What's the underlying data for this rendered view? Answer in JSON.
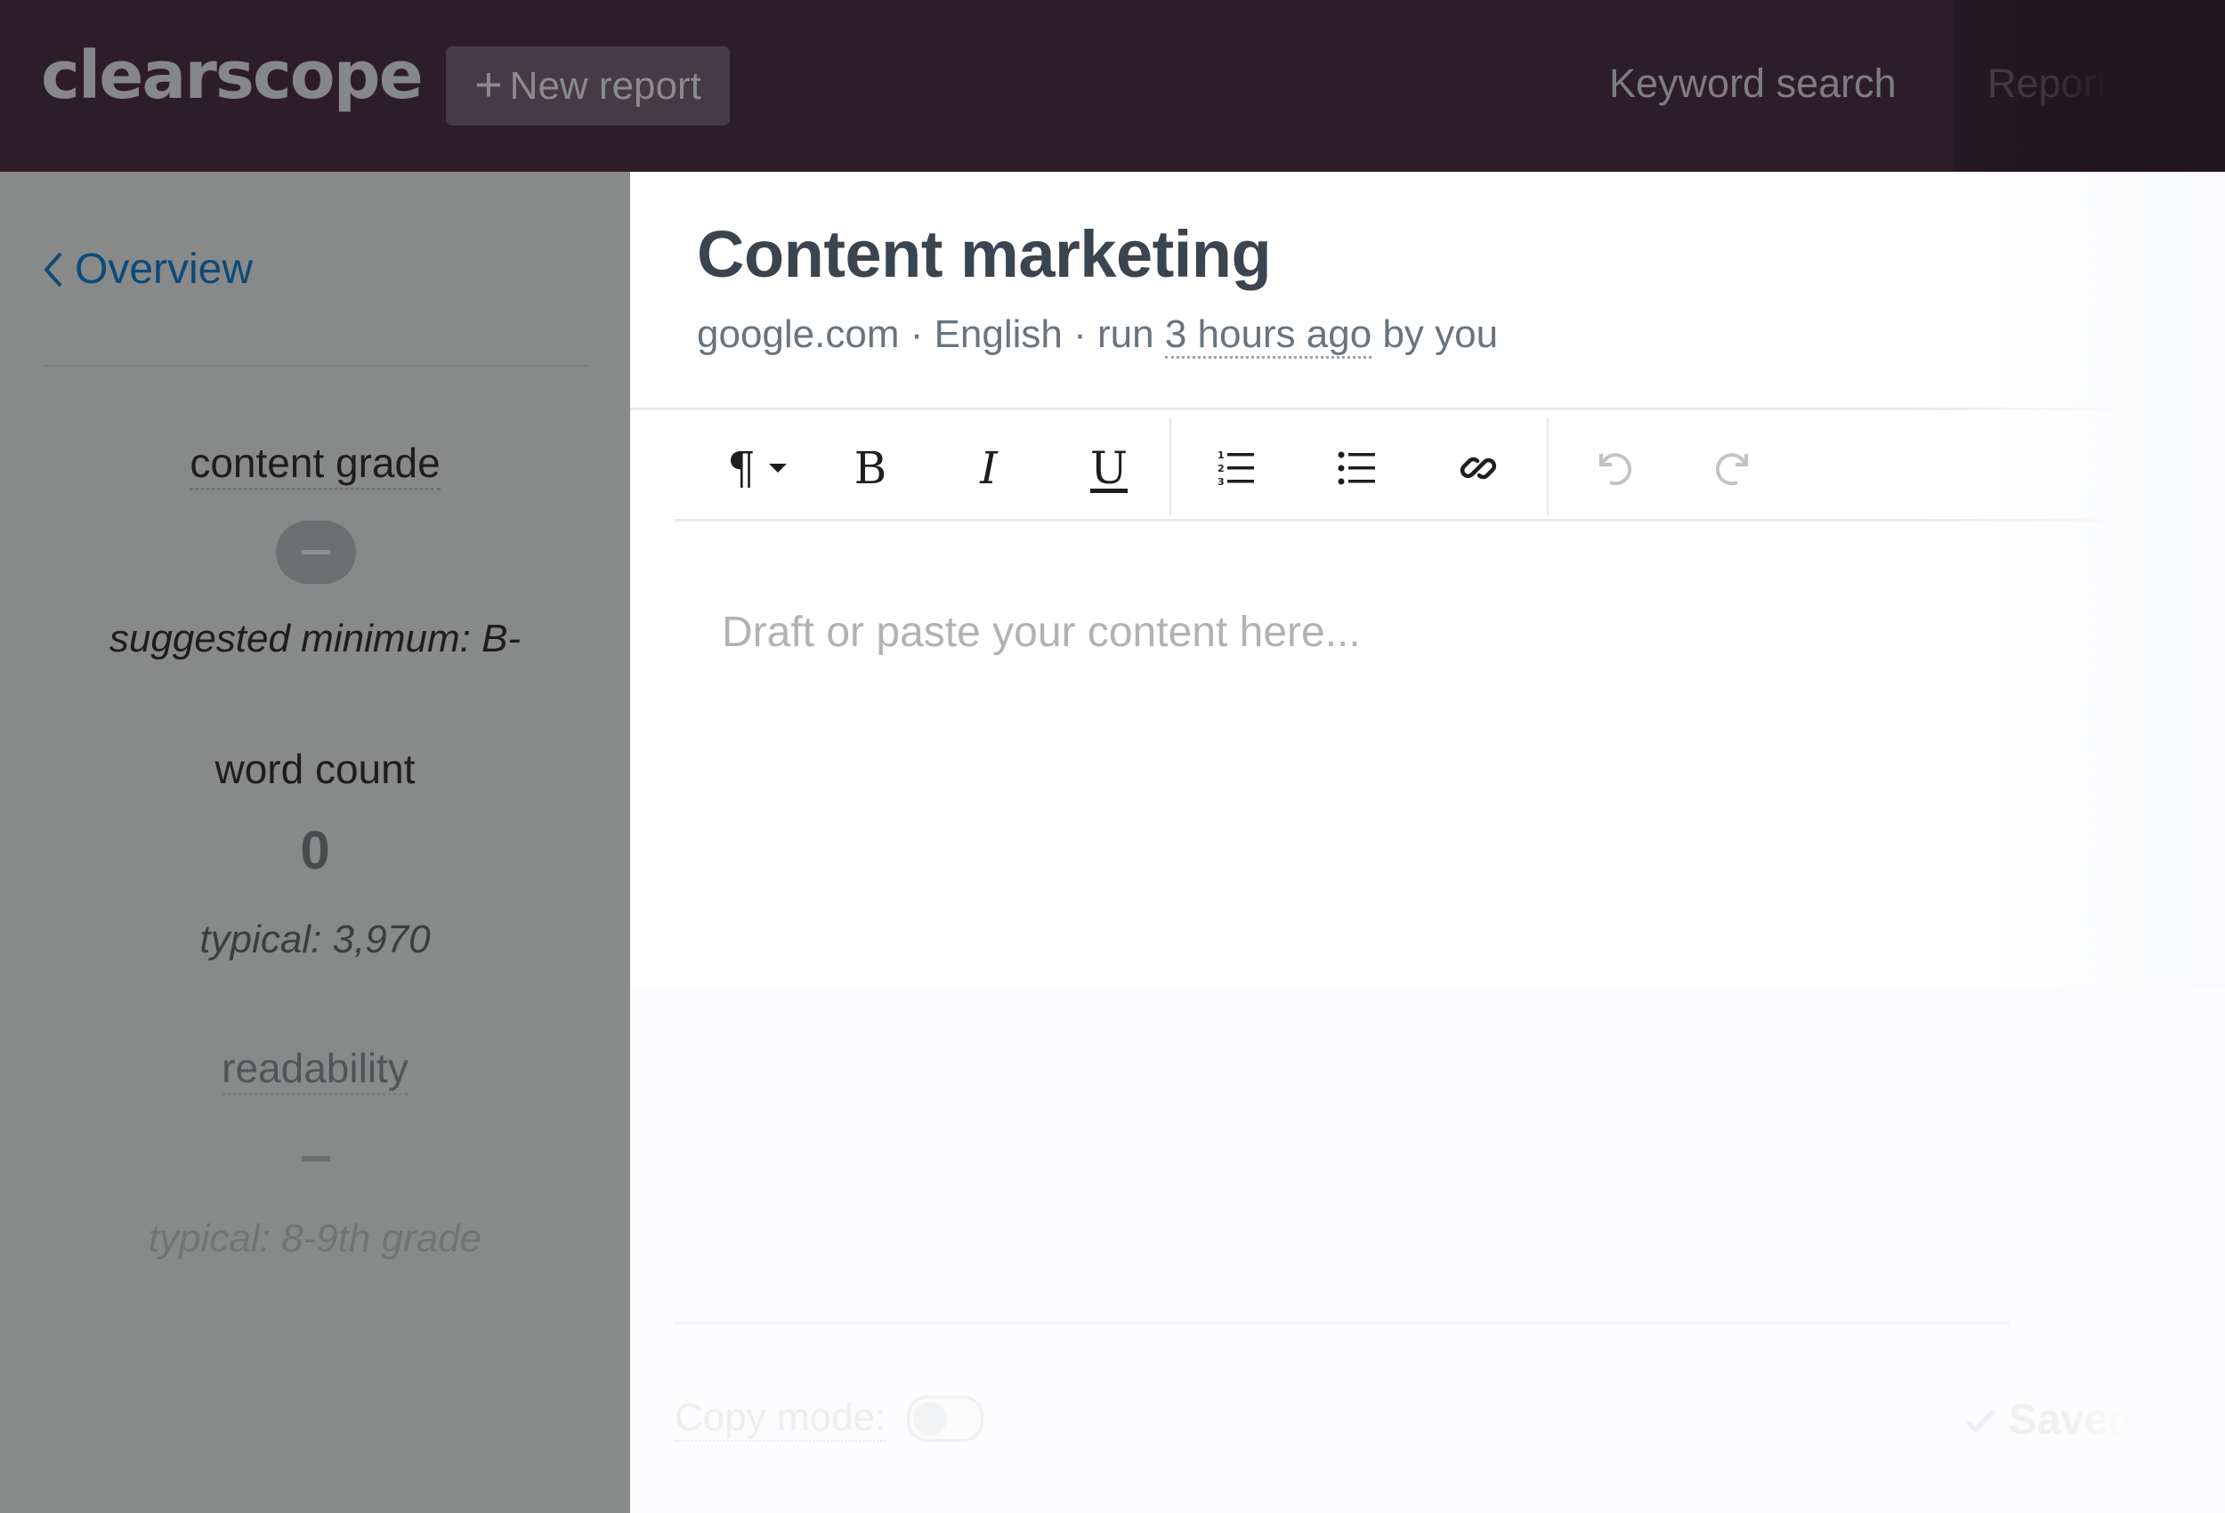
{
  "header": {
    "logo": "clearscope",
    "new_report_label": "New report",
    "nav": {
      "keyword_search": "Keyword search",
      "reports": "Reports"
    },
    "colors": {
      "background": "#2c1d28",
      "button": "#463a44"
    }
  },
  "sidebar": {
    "back_link": "Overview",
    "metrics": {
      "content_grade": {
        "label": "content grade",
        "value": "–",
        "note": "suggested minimum: B-"
      },
      "word_count": {
        "label": "word count",
        "value": "0",
        "note": "typical: 3,970"
      },
      "readability": {
        "label": "readability",
        "value": "–",
        "note": "typical: 8-9th grade"
      }
    },
    "colors": {
      "background": "#888a89",
      "link": "#0d4a78"
    }
  },
  "report": {
    "title": "Content marketing",
    "meta_prefix": "google.com · English · run ",
    "meta_time": "3 hours ago",
    "meta_suffix": " by you"
  },
  "toolbar": {
    "paragraph": "¶",
    "bold": "B",
    "italic": "I",
    "underline": "U",
    "items": [
      "paragraph-format",
      "bold",
      "italic",
      "underline",
      "ordered-list",
      "bullet-list",
      "link",
      "undo",
      "redo"
    ]
  },
  "editor": {
    "placeholder": "Draft or paste your content here..."
  },
  "footer": {
    "copy_mode_label": "Copy mode:",
    "copy_mode_on": false,
    "status": "Saved"
  }
}
